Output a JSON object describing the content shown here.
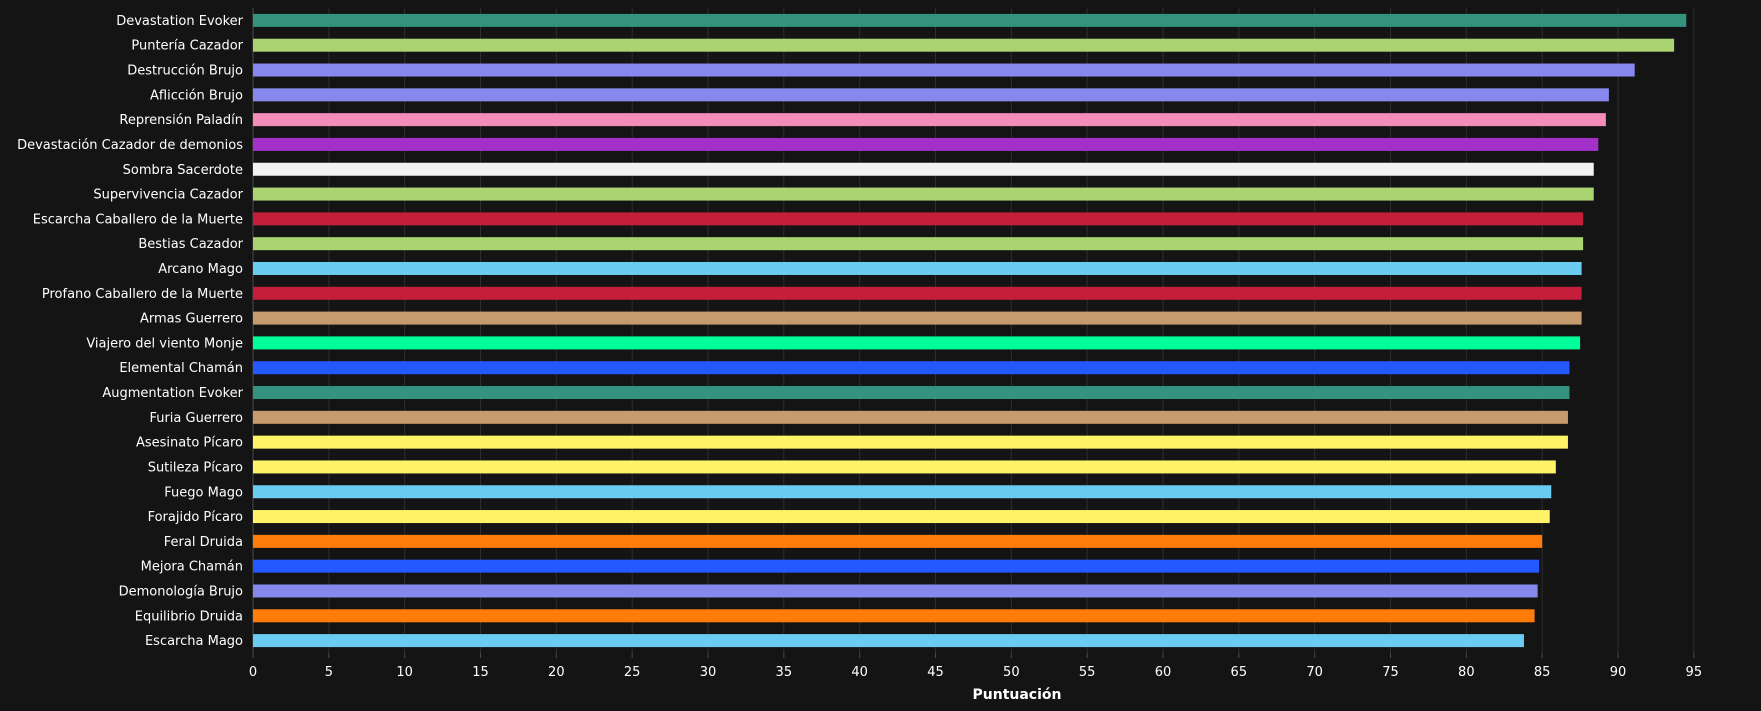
{
  "chart_data": {
    "type": "bar",
    "orientation": "horizontal",
    "title": "",
    "xlabel": "Puntuación",
    "ylabel": "",
    "xlim": [
      0,
      96
    ],
    "xticks": [
      0,
      5,
      10,
      15,
      20,
      25,
      30,
      35,
      40,
      45,
      50,
      55,
      60,
      65,
      70,
      75,
      80,
      85,
      90,
      95
    ],
    "grid": "vertical",
    "legend": "none",
    "background": "#141414",
    "bars": [
      {
        "label": "Devastation Evoker",
        "value": 94.5,
        "color": "#33937F"
      },
      {
        "label": "Puntería Cazador",
        "value": 93.7,
        "color": "#AAD372"
      },
      {
        "label": "Destrucción Brujo",
        "value": 91.1,
        "color": "#8788EE"
      },
      {
        "label": "Aflicción Brujo",
        "value": 89.4,
        "color": "#8788EE"
      },
      {
        "label": "Reprensión Paladín",
        "value": 89.2,
        "color": "#F48CBA"
      },
      {
        "label": "Devastación Cazador de demonios",
        "value": 88.7,
        "color": "#A330C9"
      },
      {
        "label": "Sombra Sacerdote",
        "value": 88.4,
        "color": "#F2F2F2"
      },
      {
        "label": "Supervivencia Cazador",
        "value": 88.4,
        "color": "#AAD372"
      },
      {
        "label": "Escarcha Caballero de la Muerte",
        "value": 87.7,
        "color": "#C41E3A"
      },
      {
        "label": "Bestias Cazador",
        "value": 87.7,
        "color": "#AAD372"
      },
      {
        "label": "Arcano Mago",
        "value": 87.6,
        "color": "#69CCF0"
      },
      {
        "label": "Profano Caballero de la Muerte",
        "value": 87.6,
        "color": "#C41E3A"
      },
      {
        "label": "Armas Guerrero",
        "value": 87.6,
        "color": "#C69B6D"
      },
      {
        "label": "Viajero del viento Monje",
        "value": 87.5,
        "color": "#00FF98"
      },
      {
        "label": "Elemental Chamán",
        "value": 86.8,
        "color": "#2459FF"
      },
      {
        "label": "Augmentation Evoker",
        "value": 86.8,
        "color": "#33937F"
      },
      {
        "label": "Furia Guerrero",
        "value": 86.7,
        "color": "#C69B6D"
      },
      {
        "label": "Asesinato Pícaro",
        "value": 86.7,
        "color": "#FFF468"
      },
      {
        "label": "Sutileza Pícaro",
        "value": 85.9,
        "color": "#FFF468"
      },
      {
        "label": "Fuego Mago",
        "value": 85.6,
        "color": "#69CCF0"
      },
      {
        "label": "Forajido Pícaro",
        "value": 85.5,
        "color": "#FFF468"
      },
      {
        "label": "Feral Druida",
        "value": 85.0,
        "color": "#FF7C0A"
      },
      {
        "label": "Mejora Chamán",
        "value": 84.8,
        "color": "#2459FF"
      },
      {
        "label": "Demonología Brujo",
        "value": 84.7,
        "color": "#8788EE"
      },
      {
        "label": "Equilibrio Druida",
        "value": 84.5,
        "color": "#FF7C0A"
      },
      {
        "label": "Escarcha Mago",
        "value": 83.8,
        "color": "#69CCF0"
      }
    ]
  }
}
